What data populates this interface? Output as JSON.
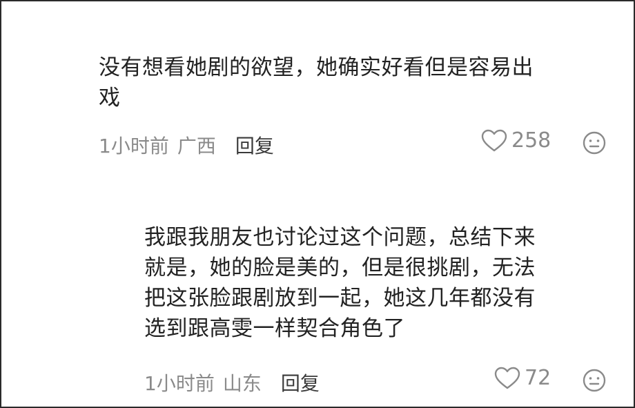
{
  "comments": [
    {
      "text_lines": [
        "没有想看她剧的欲望，她确实好看但是容易出",
        "戏"
      ],
      "time": "1小时前",
      "location": "广西",
      "reply_label": "回复",
      "likes": "258"
    },
    {
      "text_lines": [
        "我跟我朋友也讨论过这个问题，总结下来",
        "就是，她的脸是美的，但是很挑剧，无法",
        "把这张脸跟剧放到一起，她这几年都没有",
        "选到跟高雯一样契合角色了"
      ],
      "time": "1小时前",
      "location": "山东",
      "reply_label": "回复",
      "likes": "72"
    }
  ],
  "icons": {
    "like": "heart-outline-icon",
    "react": "smiley-face-icon"
  },
  "colors": {
    "text": "#222222",
    "meta": "#8a8a8a",
    "reply": "#3a3a3a",
    "border": "#2a2a2a"
  }
}
